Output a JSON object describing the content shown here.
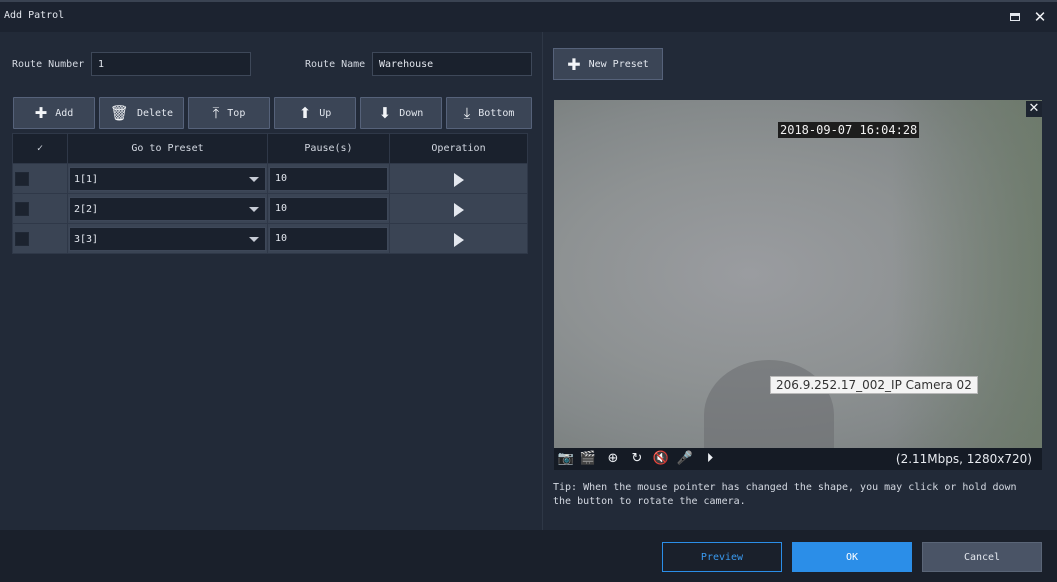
{
  "window": {
    "title": "Add Patrol"
  },
  "form": {
    "route_number_label": "Route Number",
    "route_number_value": "1",
    "route_name_label": "Route Name",
    "route_name_value": "Warehouse"
  },
  "toolbar": {
    "add_label": "Add",
    "delete_label": "Delete",
    "top_label": "Top",
    "up_label": "Up",
    "down_label": "Down",
    "bottom_label": "Bottom"
  },
  "table": {
    "columns": [
      "✓",
      "Go to Preset",
      "Pause(s)",
      "Operation"
    ],
    "rows": [
      {
        "preset": "1[1]",
        "pause": "10"
      },
      {
        "preset": "2[2]",
        "pause": "10"
      },
      {
        "preset": "3[3]",
        "pause": "10"
      }
    ]
  },
  "preview": {
    "new_preset_label": "New Preset",
    "timestamp": "2018-09-07 16:04:28",
    "camera_tooltip": "206.9.252.17_002_IP Camera 02",
    "bitrate": "(2.11Mbps, 1280x720)",
    "toolbar_icons": [
      "snapshot-icon",
      "clip-icon",
      "ptz-icon",
      "rotate-icon",
      "mute-icon",
      "talk-icon",
      "playback-icon"
    ],
    "tip": "Tip: When the mouse pointer has changed the shape, you may click or hold down the button to rotate the camera."
  },
  "footer": {
    "preview_label": "Preview",
    "ok_label": "OK",
    "cancel_label": "Cancel"
  },
  "colors": {
    "background": "#222a38",
    "accent": "#2b8ee8",
    "button": "#3b4556"
  }
}
